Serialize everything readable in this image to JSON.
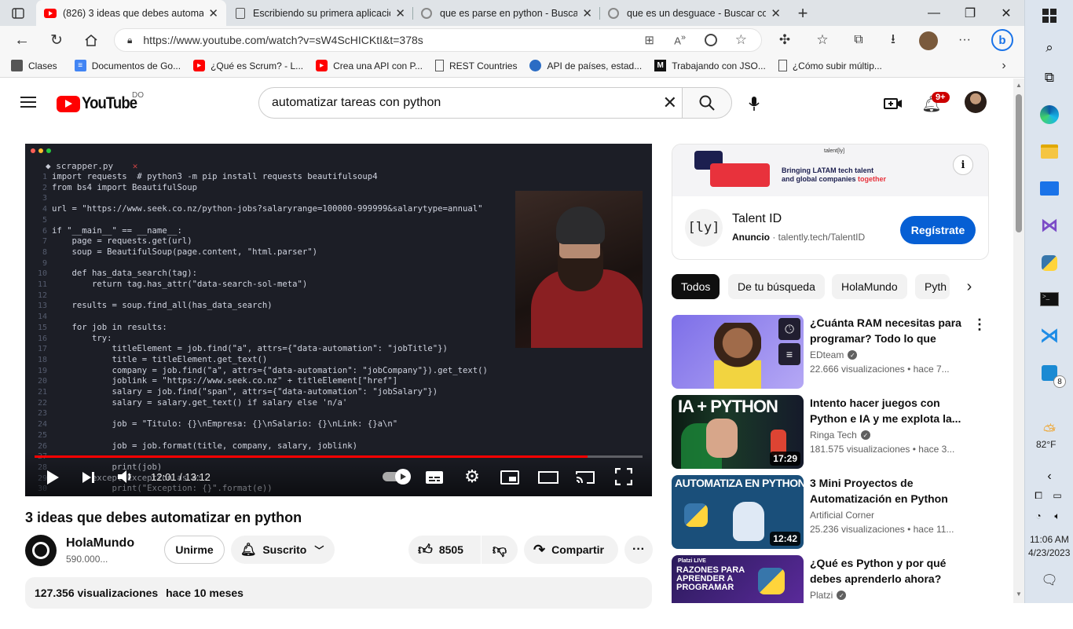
{
  "browser": {
    "tabs": [
      {
        "label": "(826) 3 ideas que debes automat",
        "active": true
      },
      {
        "label": "Escribiendo su primera aplicació"
      },
      {
        "label": "que es parse en python - Buscar"
      },
      {
        "label": "que es un desguace - Buscar con"
      }
    ],
    "url": "https://www.youtube.com/watch?v=sW4ScHICKtI&t=378s",
    "bookmarks": [
      "Clases",
      "Documentos de Go...",
      "¿Qué es Scrum? - L...",
      "Crea una API con P...",
      "REST Countries",
      "API de países, estad...",
      "Trabajando con JSO...",
      "¿Cómo subir múltip..."
    ]
  },
  "youtube": {
    "logo_text": "YouTube",
    "region": "DO",
    "search_value": "automatizar tareas con python",
    "notif_count": "9+",
    "video": {
      "file_tab": "scrapper.py",
      "code_lines": [
        "import requests  # python3 -m pip install requests beautifulsoup4",
        "from bs4 import BeautifulSoup",
        "",
        "url = \"https://www.seek.co.nz/python-jobs?salaryrange=100000-999999&salarytype=annual\"",
        "",
        "if \"__main__\" == __name__:",
        "    page = requests.get(url)",
        "    soup = BeautifulSoup(page.content, \"html.parser\")",
        "",
        "    def has_data_search(tag):",
        "        return tag.has_attr(\"data-search-sol-meta\")",
        "",
        "    results = soup.find_all(has_data_search)",
        "",
        "    for job in results:",
        "        try:",
        "            titleElement = job.find(\"a\", attrs={\"data-automation\": \"jobTitle\"})",
        "            title = titleElement.get_text()",
        "            company = job.find(\"a\", attrs={\"data-automation\": \"jobCompany\"}).get_text()",
        "            joblink = \"https://www.seek.co.nz\" + titleElement[\"href\"]",
        "            salary = job.find(\"span\", attrs={\"data-automation\": \"jobSalary\"})",
        "            salary = salary.get_text() if salary else 'n/a'",
        "",
        "            job = \"Titulo: {}\\nEmpresa: {}\\nSalario: {}\\nLink: {}a\\n\"",
        "",
        "            job = job.format(title, company, salary, joblink)",
        "",
        "            print(job)",
        "        except Exception as e:",
        "            print(\"Exception: {}\".format(e))"
      ],
      "line_numbers": "1\n2\n3\n4\n5\n6\n7\n8\n9\n10\n11\n12\n13\n14\n15\n16\n17\n18\n19\n20\n21\n22\n23\n24\n25\n26\n27\n28\n29\n30",
      "time": "12:01 / 13:12",
      "progress": 0.91,
      "title": "3 ideas que debes automatizar en python"
    },
    "channel": {
      "name": "HolaMundo",
      "subs": "590.000...",
      "join": "Unirme",
      "subscribed": "Suscrito"
    },
    "actions": {
      "likes": "8505",
      "share": "Compartir"
    },
    "desc": {
      "views": "127.356 visualizaciones",
      "ago": "hace 10 meses"
    },
    "ad": {
      "brand": "talent[ly]",
      "tagline1": "Bringing LATAM tech talent",
      "tagline2_a": "and global companies ",
      "tagline2_b": "together",
      "logo": "[ly]",
      "name": "Talent ID",
      "label": "Anuncio",
      "site": "talently.tech/TalentID",
      "cta": "Regístrate"
    },
    "chips": [
      "Todos",
      "De tu búsqueda",
      "HolaMundo",
      "Pyth"
    ],
    "recs": [
      {
        "title": "¿Cuánta RAM necesitas para programar? Todo lo que debes...",
        "channel": "EDteam",
        "meta": "22.666 visualizaciones  • hace 7...",
        "duration": ""
      },
      {
        "title": "Intento hacer juegos con Python e IA y me explota la...",
        "channel": "Ringa Tech",
        "meta": "181.575 visualizaciones  • hace 3...",
        "duration": "17:29",
        "thumb_text": "IA + PYTHON"
      },
      {
        "title": "3 Mini Proyectos de Automatización en Python",
        "channel": "Artificial Corner",
        "meta": "25.236 visualizaciones  • hace 11...",
        "duration": "12:42",
        "thumb_text": "AUTOMATIZA EN PYTHON"
      },
      {
        "title": "¿Qué es Python y por qué debes aprenderlo ahora?",
        "channel": "Platzi",
        "meta": "",
        "duration": "",
        "thumb_text": "RAZONES PARA APRENDER A PROGRAMAR",
        "thumb_brand": "Platzi LIVE"
      }
    ]
  },
  "taskbar": {
    "weather_temp": "82°F",
    "time": "11:06 AM",
    "date": "4/23/2023",
    "badge": "8"
  }
}
